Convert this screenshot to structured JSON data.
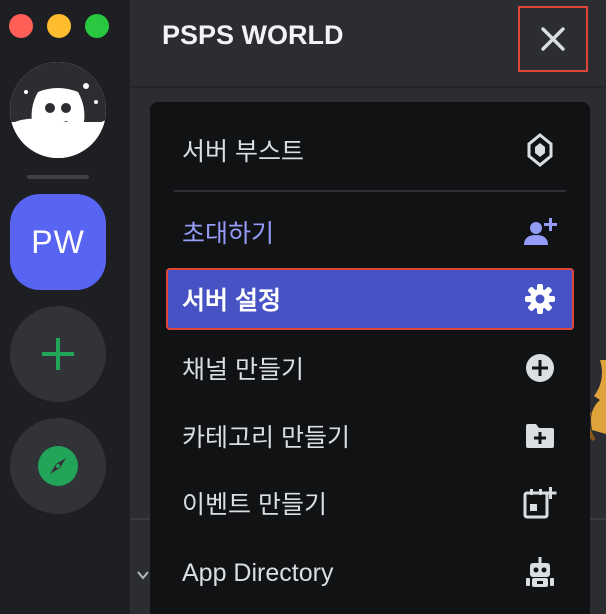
{
  "window": {
    "traffic_lights": [
      "close",
      "minimize",
      "zoom"
    ],
    "colors": {
      "red": "#ff5f57",
      "yellow": "#febc2e",
      "green": "#28c840"
    }
  },
  "server_rail": {
    "home_icon": "discord-logo-icon",
    "active_server_label": "PW",
    "active_server_color": "#5865f2",
    "add_server_icon": "plus-icon",
    "explore_icon": "compass-icon"
  },
  "header": {
    "server_name": "PSPS WORLD",
    "close_icon": "close-icon"
  },
  "menu": {
    "items": [
      {
        "label": "서버 부스트",
        "icon": "boost-gem-icon"
      },
      {
        "label": "초대하기",
        "icon": "add-user-icon"
      },
      {
        "label": "서버 설정",
        "icon": "gear-icon"
      },
      {
        "label": "채널 만들기",
        "icon": "plus-circle-icon"
      },
      {
        "label": "카테고리 만들기",
        "icon": "folder-plus-icon"
      },
      {
        "label": "이벤트 만들기",
        "icon": "calendar-plus-icon"
      },
      {
        "label": "App Directory",
        "icon": "robot-icon"
      }
    ]
  },
  "colors": {
    "accent": "#5865f2",
    "active_item": "#4752c4",
    "invite_text": "#949cf7",
    "highlight_border": "#e0453a"
  }
}
